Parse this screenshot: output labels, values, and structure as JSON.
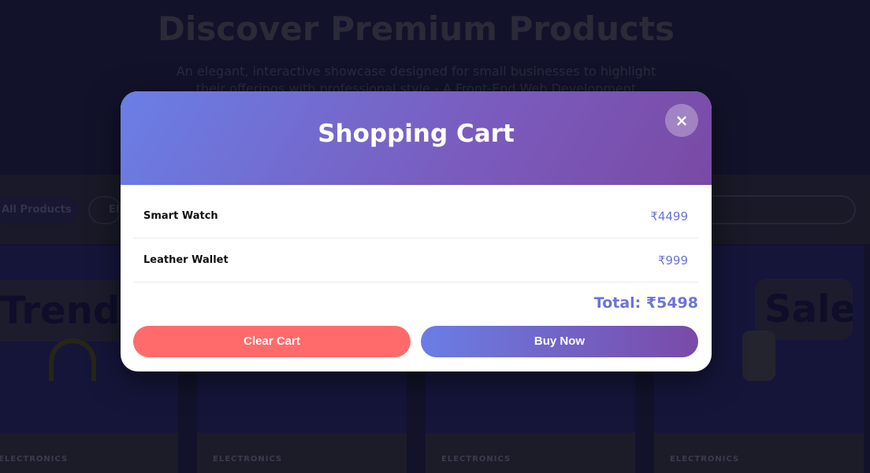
{
  "page": {
    "hero_title": "Discover Premium Products",
    "hero_subtitle": "An elegant, interactive showcase designed for small businesses to highlight their offerings with professional style - A Front-End Web Development",
    "filters": {
      "all_products": "All Products",
      "electronics": "El"
    },
    "badges": {
      "trending": "Trending",
      "sale": "Sale"
    },
    "product_category": "ELECTRONICS"
  },
  "cart": {
    "title": "Shopping Cart",
    "close_label": "×",
    "items": [
      {
        "name": "Smart Watch",
        "price": "₹4499"
      },
      {
        "name": "Leather Wallet",
        "price": "₹999"
      }
    ],
    "total": "Total: ₹5498",
    "clear_label": "Clear Cart",
    "buy_label": "Buy Now"
  },
  "colors": {
    "accent": "#6a74d8",
    "header_gradient_start": "#6a7fe6",
    "header_gradient_end": "#7a4aa5",
    "clear_button": "#ff6b6b"
  },
  "icons": {
    "close": "close-icon"
  }
}
